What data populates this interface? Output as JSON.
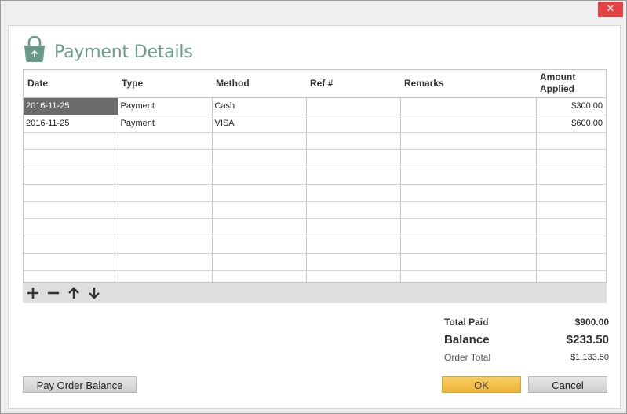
{
  "window": {
    "close_glyph": "✕"
  },
  "header": {
    "title": "Payment Details",
    "icon": "shopping-bag-icon"
  },
  "table": {
    "columns": [
      "Date",
      "Type",
      "Method",
      "Ref #",
      "Remarks",
      "Amount\nApplied"
    ],
    "rows": [
      [
        "2016-11-25",
        "Payment",
        "Cash",
        "",
        "",
        "$300.00"
      ],
      [
        "2016-11-25",
        "Payment",
        "VISA",
        "",
        "",
        "$600.00"
      ]
    ]
  },
  "toolbar": {
    "add": "add-icon",
    "remove": "remove-icon",
    "up": "arrow-up-icon",
    "down": "arrow-down-icon"
  },
  "totals": {
    "paid_label": "Total Paid",
    "paid_value": "$900.00",
    "balance_label": "Balance",
    "balance_value": "$233.50",
    "order_label": "Order Total",
    "order_value": "$1,133.50"
  },
  "buttons": {
    "pay_balance": "Pay Order Balance",
    "ok": "OK",
    "cancel": "Cancel"
  },
  "colors": {
    "accent": "#6a9a8a",
    "close": "#e04343",
    "ok": "#f2c04c",
    "selected": "#6b6b6b"
  }
}
